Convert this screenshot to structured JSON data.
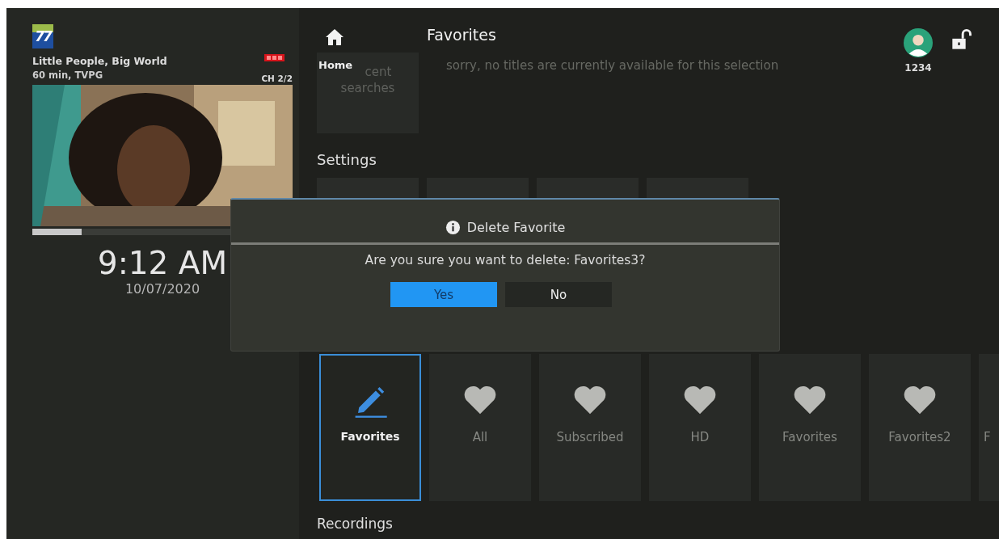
{
  "now_playing": {
    "channel_logo": "77",
    "title": "Little People, Big World",
    "details": "60 min, TVPG",
    "channel": "CH 2/2",
    "recording": true,
    "progress": {
      "level": 0.19
    }
  },
  "clock": {
    "time": "9:12 AM",
    "date": "10/07/2020"
  },
  "header": {
    "home_label": "Home",
    "title": "Favorites",
    "user": "1234",
    "locked": false
  },
  "background": {
    "recent_searches": [
      "cent",
      "searches"
    ],
    "empty_message": "sorry, no titles are currently available for this selection",
    "settings_label": "Settings"
  },
  "favorites": [
    {
      "kind": "edit",
      "label": "Favorites",
      "selected": true
    },
    {
      "kind": "heart",
      "label": "All",
      "selected": false
    },
    {
      "kind": "heart",
      "label": "Subscribed",
      "selected": false
    },
    {
      "kind": "heart",
      "label": "HD",
      "selected": false
    },
    {
      "kind": "heart",
      "label": "Favorites",
      "selected": false
    },
    {
      "kind": "heart",
      "label": "Favorites2",
      "selected": false
    },
    {
      "kind": "partial",
      "label": "F",
      "selected": false
    }
  ],
  "recordings_label": "Recordings",
  "dialog": {
    "title": "Delete Favorite",
    "message": "Are you sure you want to delete: Favorites3?",
    "buttons": [
      {
        "label": "Yes",
        "selected": true
      },
      {
        "label": "No",
        "selected": false
      }
    ]
  }
}
